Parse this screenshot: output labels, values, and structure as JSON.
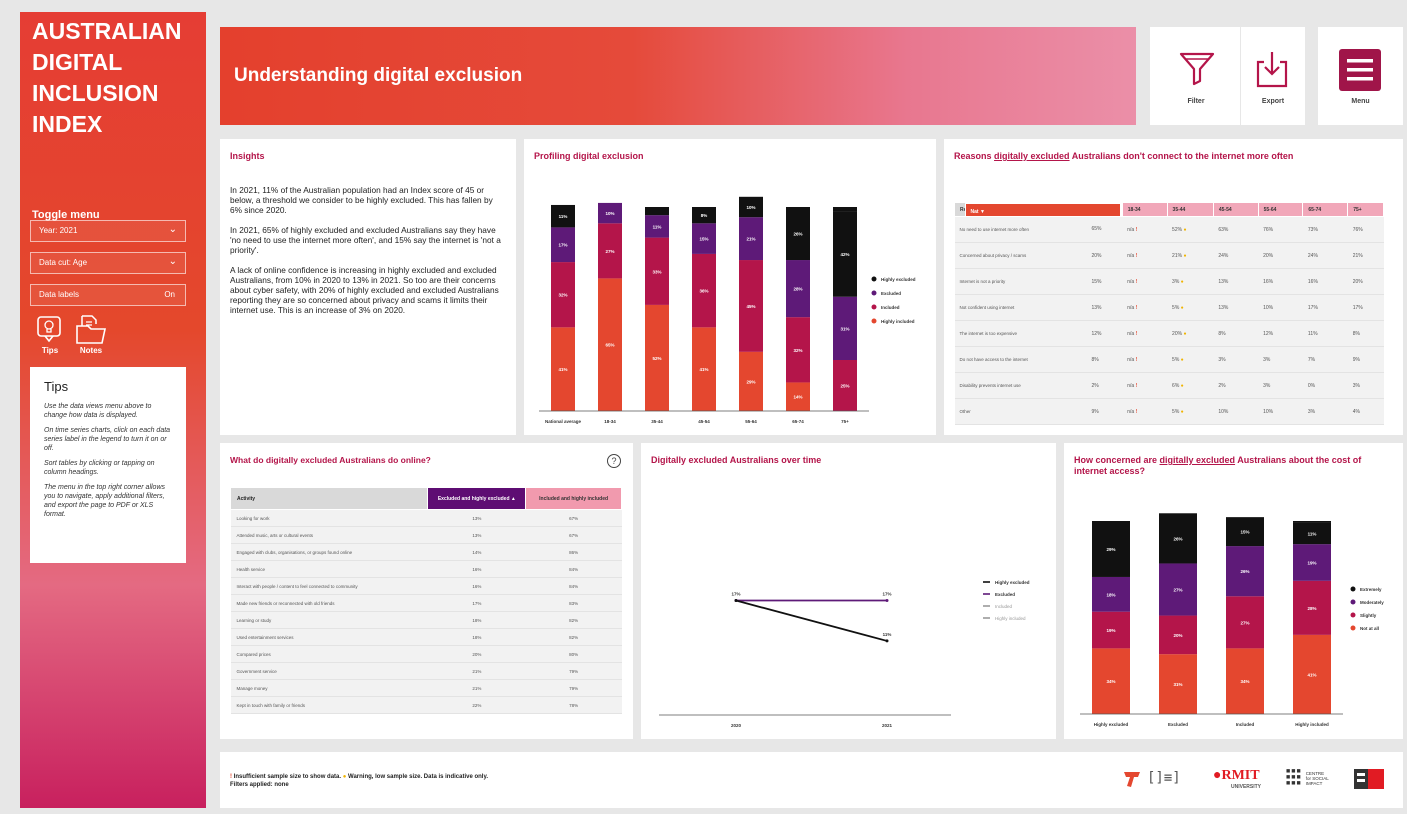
{
  "sidebar": {
    "brand_lines": [
      "AUSTRALIAN",
      "DIGITAL",
      "INCLUSION",
      "INDEX"
    ],
    "toggle_title": "Toggle menu",
    "selects": [
      {
        "label": "Year: 2021",
        "icon": "chevron-down-icon"
      },
      {
        "label": "Data cut: Age",
        "icon": "chevron-down-icon"
      }
    ],
    "data_labels": {
      "label": "Data labels",
      "value": "On"
    },
    "tips_label": "Tips",
    "notes_label": "Notes",
    "tips_box": {
      "title": "Tips",
      "paragraphs": [
        "Use the data views menu above to change how data is displayed.",
        "On time series charts, click on each data series label in the legend to turn it on or off.",
        "Sort tables by clicking or tapping on column headings.",
        "The menu in the top right corner allows you to navigate, apply additional filters, and export the page to PDF or XLS format."
      ]
    }
  },
  "header": {
    "title": "Understanding digital exclusion",
    "filter_label": "Filter",
    "export_label": "Export",
    "menu_label": "Menu"
  },
  "insights": {
    "title": "Insights",
    "paragraphs": [
      "In 2021, 11% of the Australian population had an Index score of 45 or below, a threshold we consider to be highly excluded. This has fallen by 6% since 2020.",
      "In 2021, 65% of highly excluded and excluded Australians say they have 'no need to use the internet more often', and 15% say the internet is 'not a priority'.",
      "A lack of online confidence is increasing in highly excluded and excluded Australians, from 10% in 2020 to 13% in 2021. So too are their concerns about cyber safety, with 20% of highly excluded and excluded Australians reporting they are so concerned about privacy and scams it limits their internet use. This is an increase of 3% on 2020."
    ]
  },
  "profiling": {
    "title": "Profiling digital exclusion"
  },
  "reasons": {
    "title_pre": "Reasons ",
    "title_u": "digitally excluded",
    "title_post": " Australians don't connect to the internet more often",
    "headers": [
      "Reason",
      "Nat",
      "18-34",
      "35-44",
      "45-54",
      "55-64",
      "65-74",
      "75+"
    ],
    "rows": [
      [
        "No need to use internet more often",
        "65%",
        "n/a !",
        "52% ●",
        "63%",
        "76%",
        "73%",
        "76%"
      ],
      [
        "Concerned about privacy / scams",
        "20%",
        "n/a !",
        "21% ●",
        "24%",
        "20%",
        "24%",
        "21%"
      ],
      [
        "Internet is not a priority",
        "15%",
        "n/a !",
        "3% ●",
        "13%",
        "16%",
        "16%",
        "20%"
      ],
      [
        "Not confident using internet",
        "13%",
        "n/a !",
        "5% ●",
        "13%",
        "10%",
        "17%",
        "17%"
      ],
      [
        "The internet is too expensive",
        "12%",
        "n/a !",
        "20% ●",
        "8%",
        "12%",
        "11%",
        "8%"
      ],
      [
        "Do not have access to the internet",
        "8%",
        "n/a !",
        "5% ●",
        "3%",
        "3%",
        "7%",
        "9%"
      ],
      [
        "Disability prevents internet use",
        "2%",
        "n/a !",
        "6% ●",
        "2%",
        "3%",
        "0%",
        "3%"
      ],
      [
        "Other",
        "9%",
        "n/a !",
        "5% ●",
        "10%",
        "10%",
        "3%",
        "4%"
      ]
    ]
  },
  "online": {
    "title": "What do digitally excluded Australians do online?",
    "headers": [
      "Activity",
      "Excluded and highly excluded",
      "Included and highly included"
    ],
    "rows": [
      [
        "Looking for work",
        "13%",
        "67%"
      ],
      [
        "Attended music, arts or cultural events",
        "13%",
        "67%"
      ],
      [
        "Engaged with clubs, organisations, or groups found online",
        "14%",
        "86%"
      ],
      [
        "Health service",
        "16%",
        "84%"
      ],
      [
        "Interact with people / content to feel connected to community",
        "16%",
        "84%"
      ],
      [
        "Made new friends or reconnected with old friends",
        "17%",
        "83%"
      ],
      [
        "Learning or study",
        "18%",
        "82%"
      ],
      [
        "Used entertainment services",
        "18%",
        "82%"
      ],
      [
        "Compared prices",
        "20%",
        "80%"
      ],
      [
        "Government service",
        "21%",
        "79%"
      ],
      [
        "Manage money",
        "21%",
        "79%"
      ],
      [
        "Kept in touch with family or friends",
        "22%",
        "78%"
      ]
    ]
  },
  "overtime": {
    "title": "Digitally excluded Australians over time"
  },
  "cost": {
    "title_pre": "How concerned are ",
    "title_u": "digitally excluded",
    "title_post": " Australians about the cost of internet access?"
  },
  "footer": {
    "warn1": "Insufficient sample size to show data.",
    "warn2": "Warning, low sample size. Data is indicative only.",
    "filters": "Filters applied: none",
    "rmit": "RMIT",
    "rmit_sub": "UNIVERSITY",
    "csi": "CENTRE for SOCIAL IMPACT"
  },
  "colors": {
    "highly_excluded": "#111111",
    "excluded": "#5e1a78",
    "included": "#b4154a",
    "highly_included": "#e4472f"
  },
  "chart_data": [
    {
      "type": "bar",
      "stacked": true,
      "title": "Profiling digital exclusion",
      "categories": [
        "National average",
        "18-34",
        "35-44",
        "45-54",
        "55-64",
        "65-74",
        "75+"
      ],
      "series": [
        {
          "name": "Highly included",
          "values": [
            41,
            65,
            52,
            41,
            29,
            14,
            null
          ]
        },
        {
          "name": "Included",
          "values": [
            32,
            27,
            33,
            36,
            45,
            32,
            25
          ]
        },
        {
          "name": "Excluded",
          "values": [
            17,
            10,
            11,
            15,
            21,
            28,
            31
          ]
        },
        {
          "name": "Highly excluded",
          "values": [
            11,
            null,
            null,
            8,
            10,
            26,
            42
          ]
        }
      ],
      "data_labels": [
        [
          "41%",
          "32%",
          "17%",
          "11%"
        ],
        [
          "65%",
          "27%",
          "10%",
          ""
        ],
        [
          "52%",
          "33%",
          "11%",
          ""
        ],
        [
          "41%",
          "36%",
          "15%",
          "8%"
        ],
        [
          "29%",
          "45%",
          "21%",
          "10%"
        ],
        [
          "14%",
          "32%",
          "28%",
          "26%"
        ],
        [
          "",
          "25%",
          "31%",
          "42%"
        ]
      ],
      "legend": [
        "Highly excluded",
        "Excluded",
        "Included",
        "Highly included"
      ],
      "legend_position": "right"
    },
    {
      "type": "line",
      "title": "Digitally excluded Australians over time",
      "x": [
        "2020",
        "2021"
      ],
      "series": [
        {
          "name": "Highly excluded",
          "values": [
            17,
            11
          ]
        },
        {
          "name": "Excluded",
          "values": [
            17,
            17
          ]
        },
        {
          "name": "Included",
          "values": [
            null,
            null
          ]
        },
        {
          "name": "Highly included",
          "values": [
            null,
            null
          ]
        }
      ],
      "data_labels": [
        [
          "17%",
          "11%"
        ],
        [
          "",
          "17%"
        ]
      ],
      "legend_position": "right"
    },
    {
      "type": "bar",
      "stacked": true,
      "title": "How concerned are digitally excluded Australians about the cost of internet access?",
      "categories": [
        "Highly excluded",
        "Excluded",
        "Included",
        "Highly included"
      ],
      "series": [
        {
          "name": "Not at all",
          "values": [
            34,
            31,
            34,
            41
          ]
        },
        {
          "name": "Slightly",
          "values": [
            19,
            20,
            27,
            28
          ]
        },
        {
          "name": "Moderately",
          "values": [
            18,
            27,
            26,
            19
          ]
        },
        {
          "name": "Extremely",
          "values": [
            29,
            26,
            15,
            11
          ]
        }
      ],
      "data_labels": [
        [
          "34%",
          "19%",
          "18%",
          "29%"
        ],
        [
          "31%",
          "20%",
          "27%",
          "26%"
        ],
        [
          "34%",
          "27%",
          "26%",
          "15%"
        ],
        [
          "41%",
          "28%",
          "19%",
          "11%"
        ]
      ],
      "legend": [
        "Extremely",
        "Moderately",
        "Slightly",
        "Not at all"
      ],
      "legend_position": "right"
    }
  ]
}
